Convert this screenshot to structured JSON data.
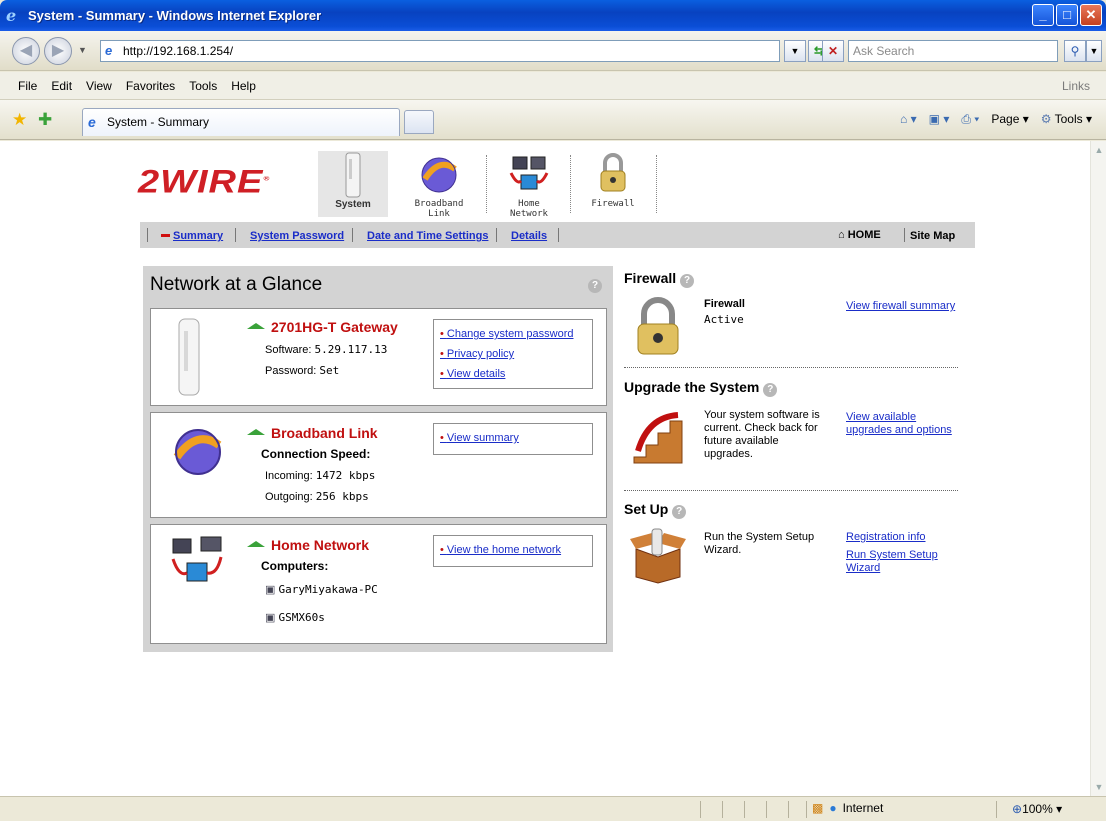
{
  "window": {
    "title": "System - Summary - Windows Internet Explorer",
    "min_label": "_",
    "max_label": "□",
    "close_label": "✕"
  },
  "address": {
    "url": "http://192.168.1.254/",
    "search_placeholder": "Ask Search"
  },
  "menu": {
    "items": [
      "File",
      "Edit",
      "View",
      "Favorites",
      "Tools",
      "Help"
    ],
    "links_label": "Links"
  },
  "tab": {
    "title": "System - Summary"
  },
  "command_bar": {
    "page_label": "Page",
    "tools_label": "Tools"
  },
  "status": {
    "zone": "Internet",
    "zoom": "100%"
  },
  "site": {
    "logo_text": "2WIRE",
    "top_tabs": [
      {
        "label": "System"
      },
      {
        "label_line1": "Broadband",
        "label_line2": "Link"
      },
      {
        "label_line1": "Home",
        "label_line2": "Network"
      },
      {
        "label": "Firewall"
      }
    ],
    "subnav": {
      "summary": "Summary",
      "password": "System Password",
      "datetime": "Date and Time Settings",
      "details": "Details",
      "home": "HOME",
      "sitemap": "Site Map"
    },
    "glance": {
      "title": "Network at a Glance",
      "gateway": {
        "title": "2701HG-T Gateway",
        "software_label": "Software:",
        "software_value": "5.29.117.13",
        "password_label": "Password:",
        "password_value": "Set",
        "links": [
          "Change system password",
          "Privacy policy",
          "View details"
        ]
      },
      "broadband": {
        "title": "Broadband Link",
        "speed_label": "Connection Speed:",
        "incoming_label": "Incoming:",
        "incoming_value": "1472 kbps",
        "outgoing_label": "Outgoing:",
        "outgoing_value": "256 kbps",
        "links": [
          "View summary"
        ]
      },
      "home": {
        "title": "Home Network",
        "computers_label": "Computers:",
        "computers": [
          "GaryMiyakawa-PC",
          "GSMX60s"
        ],
        "links": [
          "View the home network"
        ]
      }
    },
    "firewall": {
      "title": "Firewall",
      "status_label": "Firewall",
      "status_value": "Active",
      "link": "View firewall summary"
    },
    "upgrade": {
      "title": "Upgrade the System",
      "text": "Your system software is current. Check back for future available upgrades.",
      "link": "View available upgrades and options"
    },
    "setup": {
      "title": "Set Up",
      "text": "Run the System Setup Wizard.",
      "link1": "Registration info",
      "link2": "Run System Setup Wizard"
    }
  }
}
